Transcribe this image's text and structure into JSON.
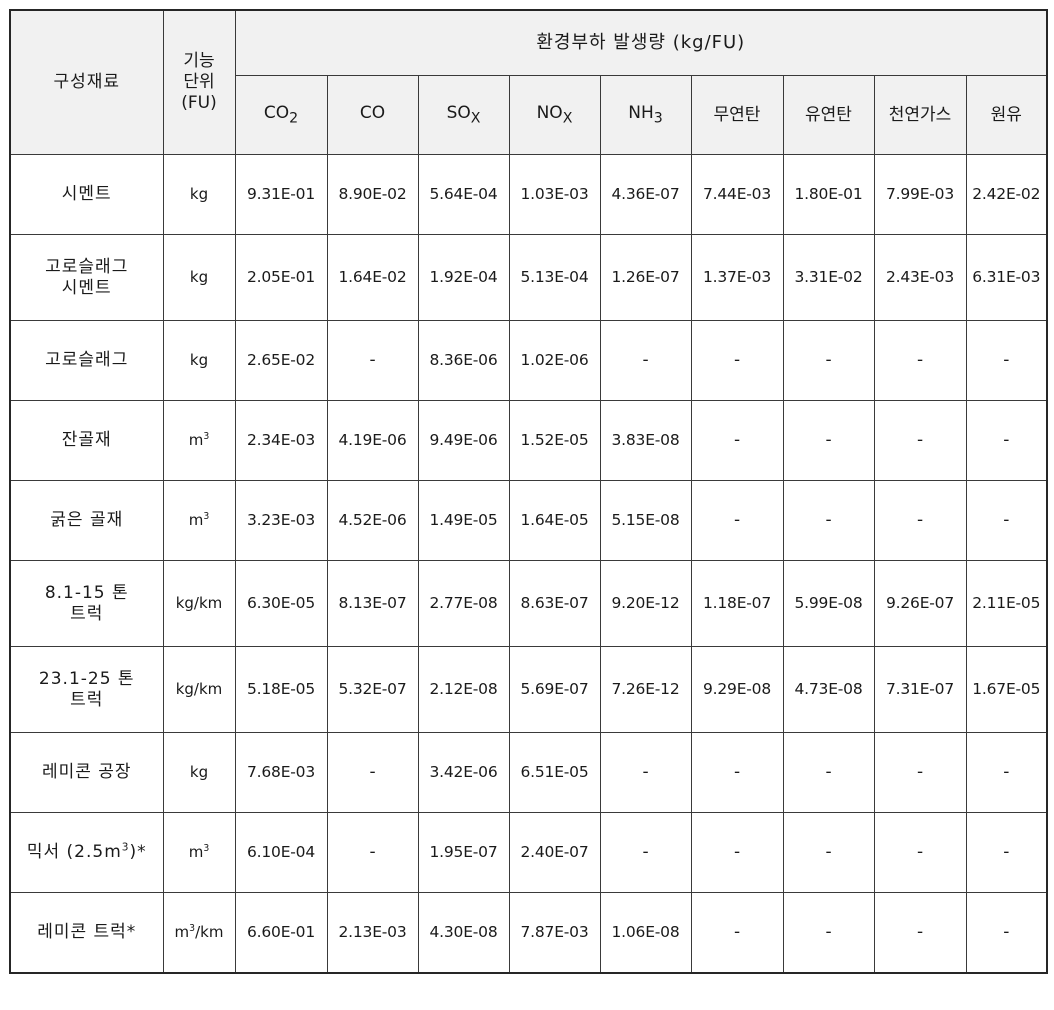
{
  "table": {
    "header": {
      "material_label": "구성재료",
      "fu_label": "기능\n단위\n(FU)",
      "fu_line1": "기능",
      "fu_line2": "단위",
      "fu_line3": "(FU)",
      "group_label": "환경부하 발생량 (kg/FU)",
      "sub_labels": [
        {
          "base": "CO",
          "sub": "2"
        },
        {
          "base": "CO",
          "sub": ""
        },
        {
          "base": "SO",
          "sub": "X"
        },
        {
          "base": "NO",
          "sub": "X"
        },
        {
          "base": "NH",
          "sub": "3"
        },
        {
          "base": "무연탄",
          "sub": ""
        },
        {
          "base": "유연탄",
          "sub": ""
        },
        {
          "base": "천연가스",
          "sub": ""
        },
        {
          "base": "원유",
          "sub": ""
        }
      ]
    },
    "rows": [
      {
        "material": "시멘트",
        "fu": "kg",
        "values": [
          "9.31E-01",
          "8.90E-02",
          "5.64E-04",
          "1.03E-03",
          "4.36E-07",
          "7.44E-03",
          "1.80E-01",
          "7.99E-03",
          "2.42E-02"
        ]
      },
      {
        "material": "고로슬래그\n시멘트",
        "material_line1": "고로슬래그",
        "material_line2": "시멘트",
        "fu": "kg",
        "values": [
          "2.05E-01",
          "1.64E-02",
          "1.92E-04",
          "5.13E-04",
          "1.26E-07",
          "1.37E-03",
          "3.31E-02",
          "2.43E-03",
          "6.31E-03"
        ]
      },
      {
        "material": "고로슬래그",
        "fu": "kg",
        "values": [
          "2.65E-02",
          "-",
          "8.36E-06",
          "1.02E-06",
          "-",
          "-",
          "-",
          "-",
          "-"
        ]
      },
      {
        "material": "잔골재",
        "fu": "m3",
        "values": [
          "2.34E-03",
          "4.19E-06",
          "9.49E-06",
          "1.52E-05",
          "3.83E-08",
          "-",
          "-",
          "-",
          "-"
        ]
      },
      {
        "material": "굵은 골재",
        "fu": "m3",
        "values": [
          "3.23E-03",
          "4.52E-06",
          "1.49E-05",
          "1.64E-05",
          "5.15E-08",
          "-",
          "-",
          "-",
          "-"
        ]
      },
      {
        "material": "8.1-15 톤\n트럭",
        "material_line1": "8.1-15 톤",
        "material_line2": "트럭",
        "fu": "kg/km",
        "values": [
          "6.30E-05",
          "8.13E-07",
          "2.77E-08",
          "8.63E-07",
          "9.20E-12",
          "1.18E-07",
          "5.99E-08",
          "9.26E-07",
          "2.11E-05"
        ]
      },
      {
        "material": "23.1-25 톤\n트럭",
        "material_line1": "23.1-25 톤",
        "material_line2": "트럭",
        "fu": "kg/km",
        "values": [
          "5.18E-05",
          "5.32E-07",
          "2.12E-08",
          "5.69E-07",
          "7.26E-12",
          "9.29E-08",
          "4.73E-08",
          "7.31E-07",
          "1.67E-05"
        ]
      },
      {
        "material": "레미콘 공장",
        "fu": "kg",
        "values": [
          "7.68E-03",
          "-",
          "3.42E-06",
          "6.51E-05",
          "-",
          "-",
          "-",
          "-",
          "-"
        ]
      },
      {
        "material": "믹서 (2.5m3)*",
        "fu": "m3",
        "values": [
          "6.10E-04",
          "-",
          "1.95E-07",
          "2.40E-07",
          "-",
          "-",
          "-",
          "-",
          "-"
        ]
      },
      {
        "material": "레미콘 트럭*",
        "fu": "m3/km",
        "values": [
          "6.60E-01",
          "2.13E-03",
          "4.30E-08",
          "7.87E-03",
          "1.06E-08",
          "-",
          "-",
          "-",
          "-"
        ]
      }
    ]
  },
  "colors": {
    "header_background": "#f1f1f1",
    "border": "#3a3a3a",
    "outer_border": "#262626",
    "text": "#1a1a1a",
    "cell_background": "#ffffff"
  }
}
